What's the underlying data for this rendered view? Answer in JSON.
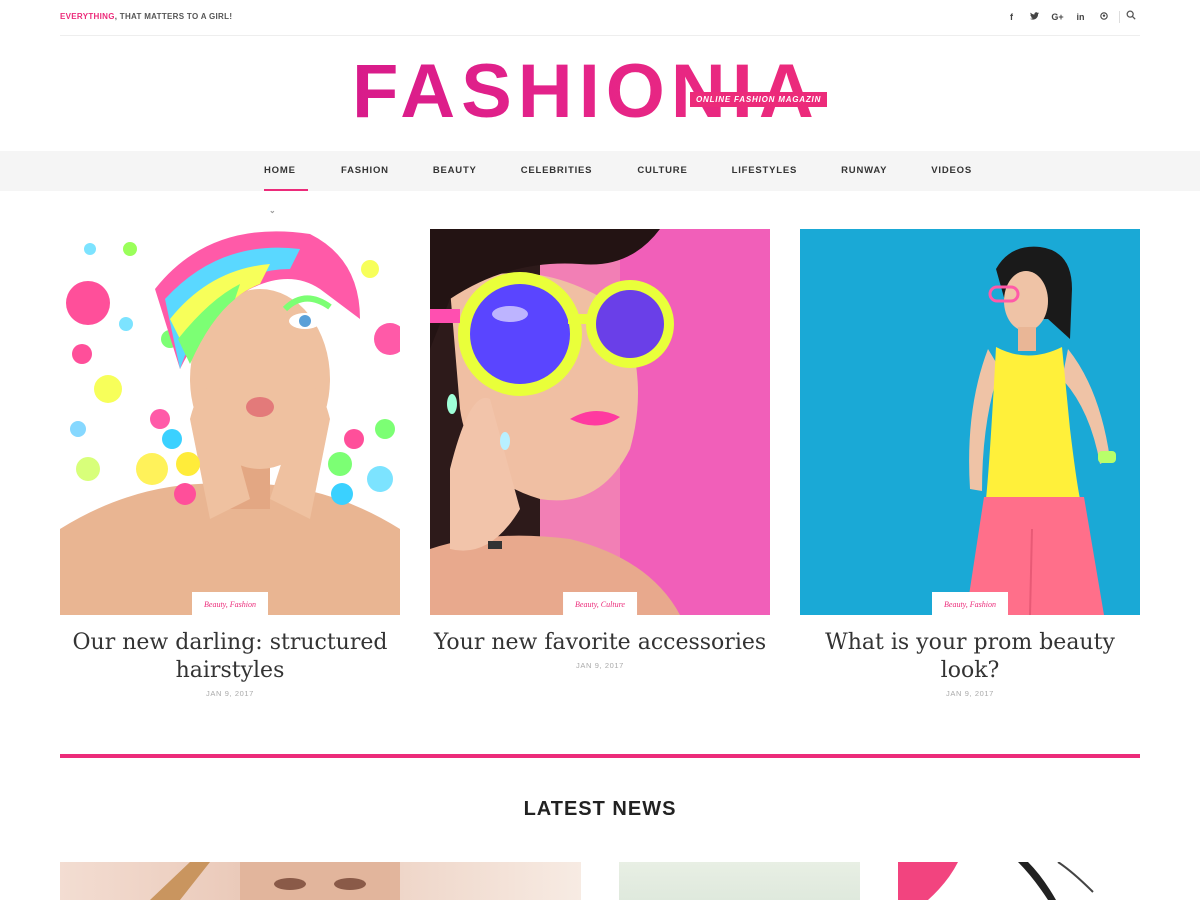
{
  "topbar": {
    "tagline_accent": "Everything",
    "tagline_rest": ", that matters to a girl!",
    "social": [
      {
        "icon": "facebook-icon",
        "glyph": "f"
      },
      {
        "icon": "twitter-icon",
        "glyph": "𝕥"
      },
      {
        "icon": "google-plus-icon",
        "glyph": "G+"
      },
      {
        "icon": "linkedin-icon",
        "glyph": "in"
      },
      {
        "icon": "pinterest-icon",
        "glyph": "℗"
      }
    ]
  },
  "logo": {
    "text": "FASHIONIA",
    "badge": "Online Fashion Magazin"
  },
  "nav": {
    "items": [
      {
        "label": "Home",
        "active": true,
        "has_dropdown": true
      },
      {
        "label": "Fashion"
      },
      {
        "label": "Beauty"
      },
      {
        "label": "Celebrities"
      },
      {
        "label": "Culture"
      },
      {
        "label": "Lifestyles"
      },
      {
        "label": "Runway"
      },
      {
        "label": "Videos"
      }
    ]
  },
  "featured": [
    {
      "category": "Beauty, Fashion",
      "title": "Our new darling: structured hairstyles",
      "date": "JAN 9, 2017"
    },
    {
      "category": "Beauty, Culture",
      "title": "Your new favorite accessories",
      "date": "JAN 9, 2017"
    },
    {
      "category": "Beauty, Fashion",
      "title": "What is your prom beauty look?",
      "date": "JAN 9, 2017"
    }
  ],
  "latest": {
    "title": "LATEST NEWS"
  },
  "colors": {
    "accent": "#ec2b7a",
    "nav_bg": "#f5f5f5"
  }
}
